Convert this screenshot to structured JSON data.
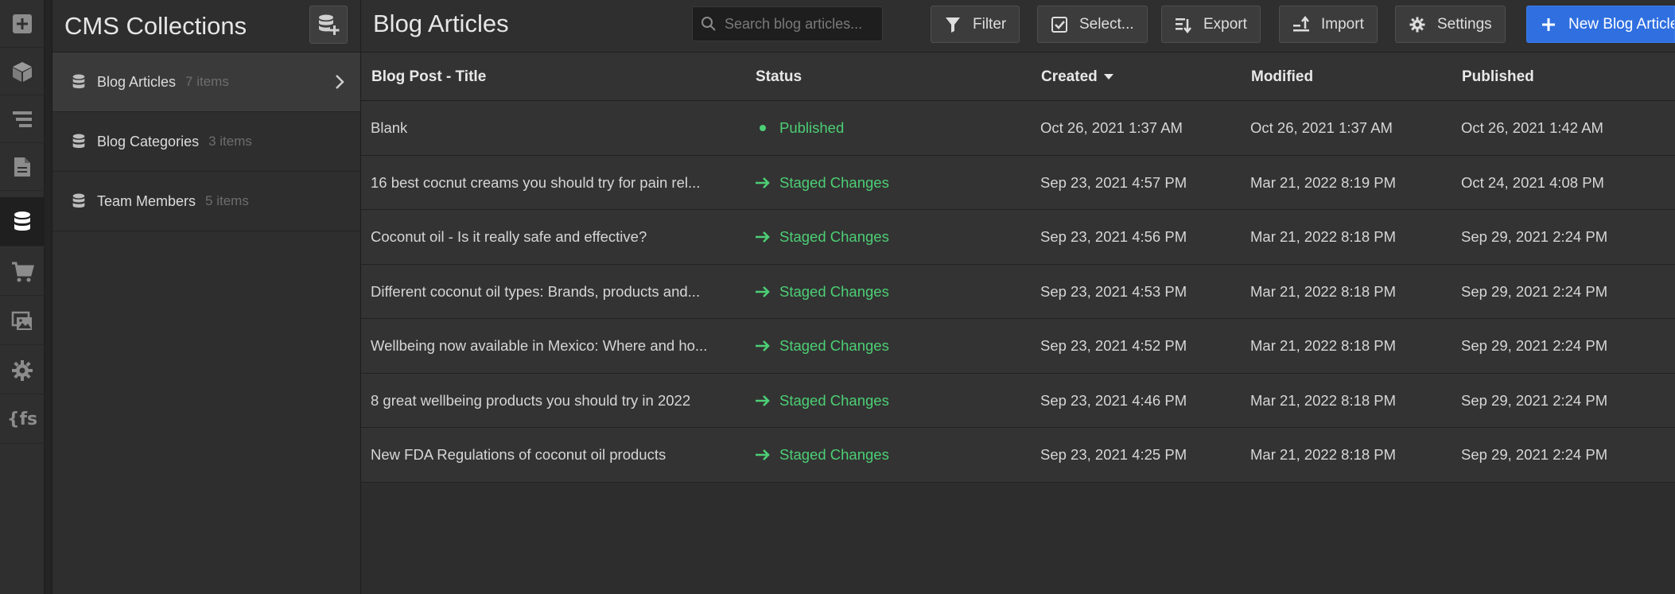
{
  "app": {
    "accent": "#2f6fe0",
    "status_color": "#4ccf75"
  },
  "rail": {
    "items": [
      {
        "name": "add",
        "icon": "plus-square-icon"
      },
      {
        "name": "components",
        "icon": "cube-icon"
      },
      {
        "name": "navigator",
        "icon": "layers-icon"
      },
      {
        "name": "pages",
        "icon": "page-icon"
      },
      {
        "name": "cms",
        "icon": "database-icon",
        "active": true
      },
      {
        "name": "ecommerce",
        "icon": "cart-icon"
      },
      {
        "name": "assets",
        "icon": "images-icon"
      },
      {
        "name": "settings",
        "icon": "gear-icon"
      },
      {
        "name": "finsweet",
        "icon": "fs-icon",
        "label": "{fs"
      }
    ]
  },
  "collections": {
    "title": "CMS Collections",
    "items": [
      {
        "name": "Blog Articles",
        "count": "7 items",
        "active": true
      },
      {
        "name": "Blog Categories",
        "count": "3 items"
      },
      {
        "name": "Team Members",
        "count": "5 items"
      }
    ]
  },
  "main": {
    "title": "Blog Articles",
    "search_placeholder": "Search blog articles...",
    "toolbar": {
      "filter": "Filter",
      "select": "Select...",
      "export": "Export",
      "import": "Import",
      "settings": "Settings",
      "new": "New Blog Article"
    },
    "columns": [
      "Blog Post - Title",
      "Status",
      "Created",
      "Modified",
      "Published"
    ],
    "sorted_column": "Created",
    "rows": [
      {
        "title": "Blank",
        "status": "Published",
        "created": "Oct 26, 2021 1:37 AM",
        "modified": "Oct 26, 2021 1:37 AM",
        "published": "Oct 26, 2021 1:42 AM"
      },
      {
        "title": "16 best cocnut creams you should try for pain rel...",
        "status": "Staged Changes",
        "created": "Sep 23, 2021 4:57 PM",
        "modified": "Mar 21, 2022 8:19 PM",
        "published": "Oct 24, 2021 4:08 PM"
      },
      {
        "title": "Coconut oil - Is it really safe and effective?",
        "status": "Staged Changes",
        "created": "Sep 23, 2021 4:56 PM",
        "modified": "Mar 21, 2022 8:18 PM",
        "published": "Sep 29, 2021 2:24 PM"
      },
      {
        "title": "Different coconut oil types: Brands, products and...",
        "status": "Staged Changes",
        "created": "Sep 23, 2021 4:53 PM",
        "modified": "Mar 21, 2022 8:18 PM",
        "published": "Sep 29, 2021 2:24 PM"
      },
      {
        "title": "Wellbeing now available in Mexico: Where and ho...",
        "status": "Staged Changes",
        "created": "Sep 23, 2021 4:52 PM",
        "modified": "Mar 21, 2022 8:18 PM",
        "published": "Sep 29, 2021 2:24 PM"
      },
      {
        "title": "8 great wellbeing products you should try in 2022",
        "status": "Staged Changes",
        "created": "Sep 23, 2021 4:46 PM",
        "modified": "Mar 21, 2022 8:18 PM",
        "published": "Sep 29, 2021 2:24 PM"
      },
      {
        "title": "New FDA Regulations of coconut oil products",
        "status": "Staged Changes",
        "created": "Sep 23, 2021 4:25 PM",
        "modified": "Mar 21, 2022 8:18 PM",
        "published": "Sep 29, 2021 2:24 PM"
      }
    ]
  }
}
